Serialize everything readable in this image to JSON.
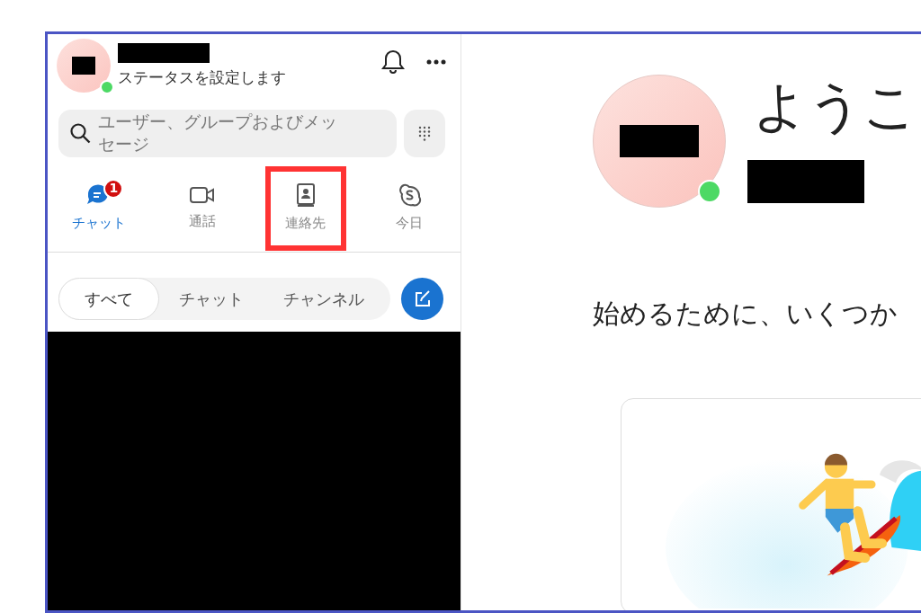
{
  "profile": {
    "status_text": "ステータスを設定します",
    "online": true
  },
  "search": {
    "placeholder": "ユーザー、グループおよびメッセージ"
  },
  "nav_tabs": [
    {
      "kind": "chat",
      "label": "チャット",
      "selected": true,
      "badge": "1",
      "highlighted": false
    },
    {
      "kind": "call",
      "label": "通話",
      "selected": false,
      "highlighted": false
    },
    {
      "kind": "contacts",
      "label": "連絡先",
      "selected": false,
      "highlighted": true
    },
    {
      "kind": "today",
      "label": "今日",
      "selected": false,
      "highlighted": false
    }
  ],
  "filters": [
    {
      "label": "すべて",
      "selected": true
    },
    {
      "label": "チャット",
      "selected": false
    },
    {
      "label": "チャンネル",
      "selected": false
    }
  ],
  "welcome": {
    "heading": "ようこ",
    "online": true,
    "subtitle": "始めるために、いくつか"
  }
}
